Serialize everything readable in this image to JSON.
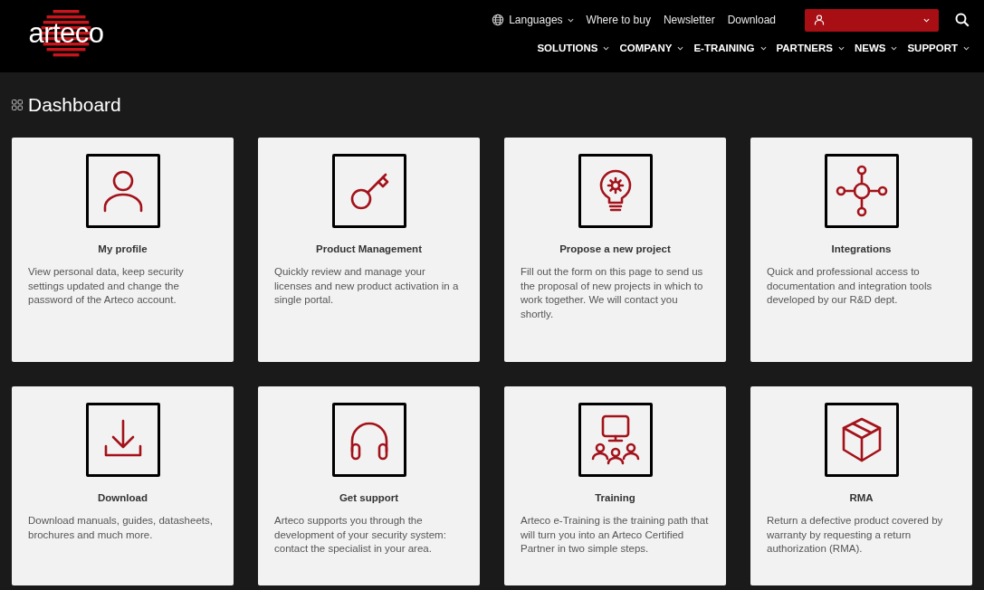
{
  "logo": {
    "text": "arteco"
  },
  "top_links": [
    {
      "label": "Languages",
      "kind": "language"
    },
    {
      "label": "Where to buy",
      "kind": "link"
    },
    {
      "label": "Newsletter",
      "kind": "link"
    },
    {
      "label": "Download",
      "kind": "link"
    }
  ],
  "main_nav": [
    "SOLUTIONS",
    "COMPANY",
    "E-TRAINING",
    "PARTNERS",
    "NEWS",
    "SUPPORT"
  ],
  "page_title": "Dashboard",
  "cards": [
    {
      "kind": "profile",
      "title": "My profile",
      "description": "View personal data, keep security settings updated and change the password of the Arteco account."
    },
    {
      "kind": "key",
      "title": "Product Management",
      "description": "Quickly review and manage your licenses and new product activation in a single portal."
    },
    {
      "kind": "idea",
      "title": "Propose a new project",
      "description": "Fill out the form on this page to send us the proposal of new projects in which to work together. We will contact you shortly."
    },
    {
      "kind": "hub",
      "title": "Integrations",
      "description": "Quick and professional access to documentation and integration tools developed by our R&D dept."
    },
    {
      "kind": "download",
      "title": "Download",
      "description": "Download manuals, guides, datasheets, brochures and much more."
    },
    {
      "kind": "headset",
      "title": "Get support",
      "description": "Arteco supports you through the development of your security system: contact the specialist in your area."
    },
    {
      "kind": "training",
      "title": "Training",
      "description": "Arteco e-Training is the training path that will turn you into an Arteco Certified Partner in two simple steps."
    },
    {
      "kind": "box",
      "title": "RMA",
      "description": "Return a defective product covered by warranty by requesting a return authorization (RMA)."
    }
  ]
}
